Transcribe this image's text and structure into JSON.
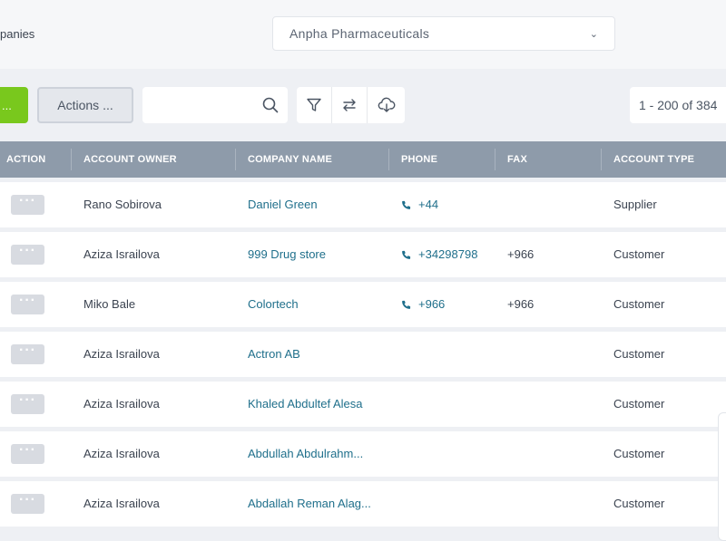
{
  "breadcrumb": "panies",
  "company_selector": {
    "value": "Anpha Pharmaceuticals"
  },
  "toolbar": {
    "primary_label": "...",
    "actions_label": "Actions ...",
    "search_placeholder": "",
    "pagination": "1 - 200 of 384"
  },
  "columns": [
    "ACTION",
    "ACCOUNT OWNER",
    "COMPANY NAME",
    "PHONE",
    "FAX",
    "ACCOUNT TYPE"
  ],
  "rows": [
    {
      "owner": "Rano Sobirova",
      "company": "Daniel Green",
      "phone": "+44",
      "fax": "",
      "type": "Supplier"
    },
    {
      "owner": "Aziza Israilova",
      "company": "999 Drug store",
      "phone": "+34298798",
      "fax": "+966",
      "type": "Customer"
    },
    {
      "owner": "Miko Bale",
      "company": "Colortech",
      "phone": "+966",
      "fax": "+966",
      "type": "Customer"
    },
    {
      "owner": "Aziza Israilova",
      "company": "Actron AB",
      "phone": "",
      "fax": "",
      "type": "Customer"
    },
    {
      "owner": "Aziza Israilova",
      "company": "Khaled Abdultef Alesa",
      "phone": "",
      "fax": "",
      "type": "Customer"
    },
    {
      "owner": "Aziza Israilova",
      "company": "Abdullah Abdulrahm...",
      "phone": "",
      "fax": "",
      "type": "Customer"
    },
    {
      "owner": "Aziza Israilova",
      "company": "Abdallah Reman Alag...",
      "phone": "",
      "fax": "",
      "type": "Customer"
    }
  ],
  "row_action_label": "···",
  "colors": {
    "accent_green": "#79c81d",
    "header_bg": "#8e9baa",
    "link": "#1f6f8b"
  }
}
